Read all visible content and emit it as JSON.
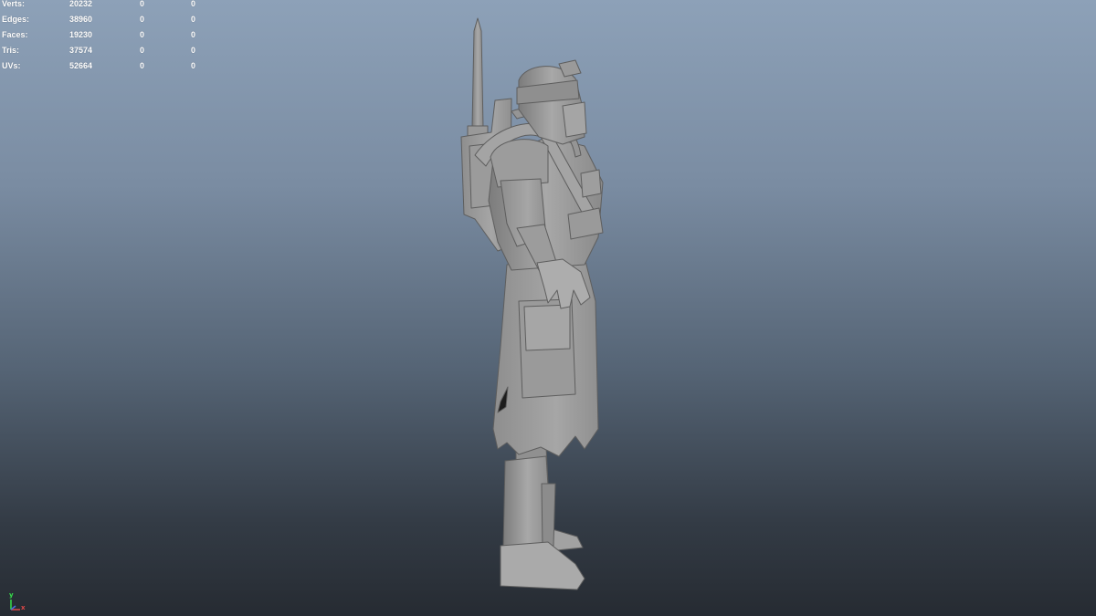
{
  "hud": {
    "rows": [
      {
        "label": "Verts:",
        "total": "20232",
        "selected": "0",
        "component": "0"
      },
      {
        "label": "Edges:",
        "total": "38960",
        "selected": "0",
        "component": "0"
      },
      {
        "label": "Faces:",
        "total": "19230",
        "selected": "0",
        "component": "0"
      },
      {
        "label": "Tris:",
        "total": "37574",
        "selected": "0",
        "component": "0"
      },
      {
        "label": "UVs:",
        "total": "52664",
        "selected": "0",
        "component": "0"
      }
    ]
  },
  "axis": {
    "y_label": "y",
    "x_label": "x",
    "y_color": "#35e04a",
    "x_color": "#e04848"
  },
  "colors": {
    "bg_top": "#8da1b8",
    "bg_bottom": "#262b32",
    "model_fill": "#a0a0a0",
    "hud_text": "#ffffff"
  },
  "icons": [
    "view-axis-gizmo-icon"
  ]
}
